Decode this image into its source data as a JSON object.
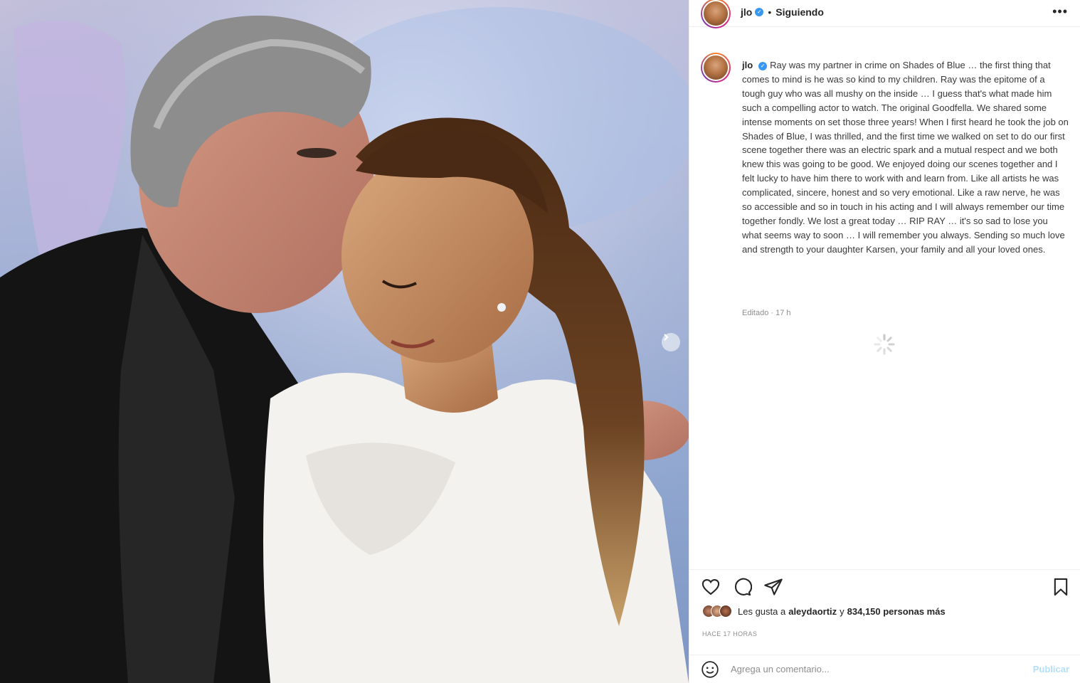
{
  "post": {
    "photo_alt": "",
    "carousel_next_icon": "chevron-right-icon"
  },
  "header": {
    "username": "jlo",
    "verified_icon": "verified-badge-icon",
    "separator": "•",
    "follow_status": "Siguiendo",
    "more_icon": "more-options-icon",
    "more_label": "•••"
  },
  "caption": {
    "username": "jlo",
    "text": "Ray was my partner in crime on Shades of Blue … the first thing that comes to mind is he was so kind to my children. Ray was the epitome of a tough guy who was all mushy on the inside … I guess that's what made him such a compelling actor to watch. The original Goodfella. We shared some intense moments on set those three years! When I first heard he took the job on Shades of Blue, I was thrilled, and the first time we walked on set to do our first scene together there was an electric spark and a mutual respect and we both knew this was going to be good. We enjoyed doing our scenes together and I felt lucky to have him there to work with and learn from. Like all artists he was complicated, sincere, honest and so very emotional. Like a raw nerve, he was so accessible and so in touch in his acting and I will always remember our time together fondly. We lost a great today … RIP RAY … it's so sad to lose you what seems way to soon … I will remember you always. Sending so much love and strength to your daughter Karsen, your family and all your loved ones.",
    "edited": "Editado · 17 h"
  },
  "actions": {
    "like_icon": "heart-icon",
    "comment_icon": "comment-icon",
    "share_icon": "send-icon",
    "save_icon": "bookmark-icon"
  },
  "likes": {
    "prefix": "Les gusta a",
    "first_liker": "aleydaortiz",
    "connector": "y",
    "others": "834,150 personas más"
  },
  "timestamp": "HACE 17 HORAS",
  "comment": {
    "emoji_icon": "emoji-icon",
    "placeholder": "Agrega un comentario...",
    "post_label": "Publicar"
  },
  "colors": {
    "accent_link": "#b2dffc",
    "verified": "#3897f0",
    "text": "#262626",
    "muted": "#8e8e8e"
  }
}
